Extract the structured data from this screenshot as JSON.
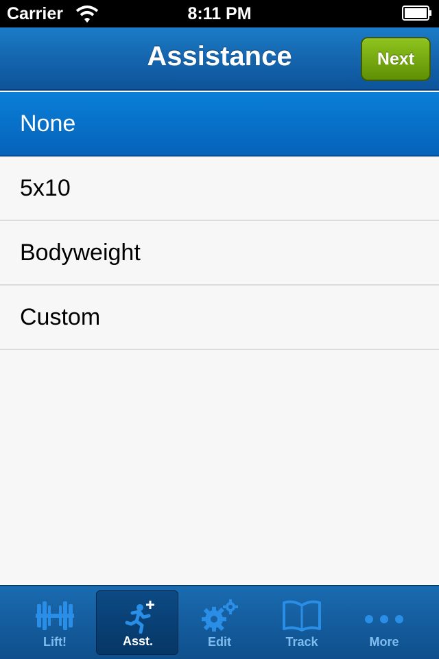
{
  "status_bar": {
    "carrier": "Carrier",
    "time": "8:11 PM"
  },
  "nav": {
    "title": "Assistance",
    "next_label": "Next"
  },
  "options": [
    "None",
    "5x10",
    "Bodyweight",
    "Custom"
  ],
  "selected_option": "None",
  "tabs": [
    {
      "label": "Lift!",
      "icon": "barbell-icon"
    },
    {
      "label": "Asst.",
      "icon": "runner-plus-icon"
    },
    {
      "label": "Edit",
      "icon": "gears-icon"
    },
    {
      "label": "Track",
      "icon": "book-icon"
    },
    {
      "label": "More",
      "icon": "more-dots-icon"
    }
  ],
  "active_tab": "Asst.",
  "colors": {
    "nav_blue": "#1565ae",
    "next_green": "#6a9a0b",
    "selected_row": "#0a7fd8",
    "tab_icon": "#2a8ee6"
  }
}
